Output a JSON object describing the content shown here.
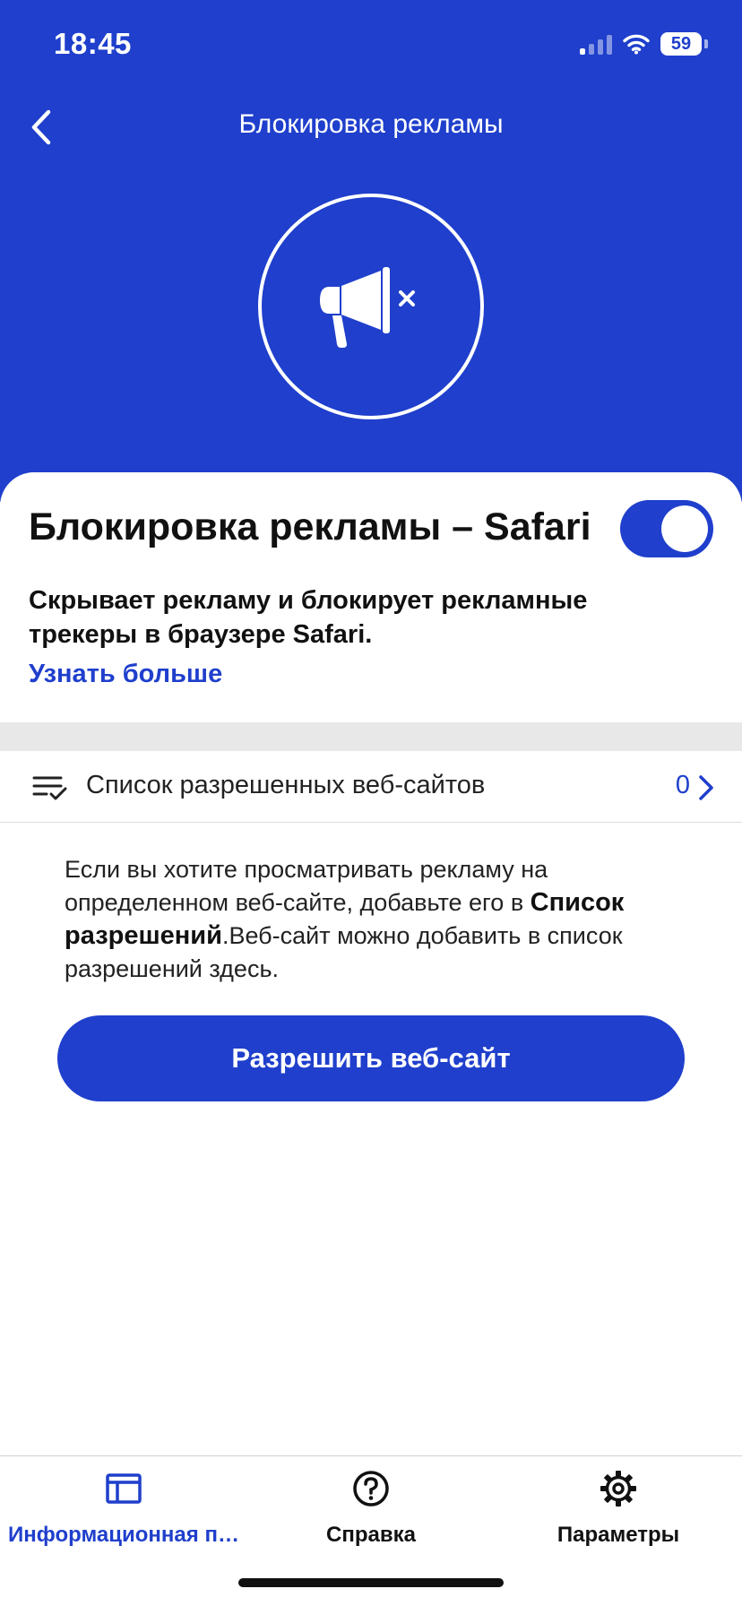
{
  "status_bar": {
    "time": "18:45",
    "battery": "59"
  },
  "nav": {
    "title": "Блокировка рекламы",
    "back_icon": "chevron-left-icon"
  },
  "hero": {
    "icon": "megaphone-blocked-icon"
  },
  "feature": {
    "title": "Блокировка рекламы – Safari",
    "enabled": true,
    "description": "Скрывает рекламу и блокирует рекламные трекеры в браузере Safari.",
    "learn_more": "Узнать больше"
  },
  "allow_list": {
    "icon": "checklist-icon",
    "label": "Список разрешенных веб-сайтов",
    "count": "0"
  },
  "info": {
    "text_1": "Если вы хотите просматривать рекламу на определенном веб-сайте, добавьте его в ",
    "text_bold": "Список разрешений",
    "text_2": ".Веб-сайт можно добавить в список разрешений здесь."
  },
  "primary_button": {
    "label": "Разрешить веб-сайт"
  },
  "tabs": [
    {
      "label": "Информационная п…",
      "icon": "dashboard-icon",
      "active": true
    },
    {
      "label": "Справка",
      "icon": "help-icon",
      "active": false
    },
    {
      "label": "Параметры",
      "icon": "gear-icon",
      "active": false
    }
  ],
  "colors": {
    "brand": "#1f3fcc",
    "divider": "#e8e8e8"
  }
}
